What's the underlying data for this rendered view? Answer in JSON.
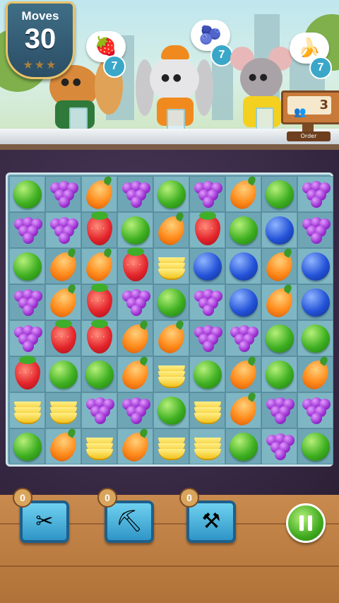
{
  "hud": {
    "moves_label": "Moves",
    "moves_value": "30",
    "order_label": "Order",
    "order_value": "3"
  },
  "customers": [
    {
      "name_icon": "squirrel",
      "wants": "strawberry",
      "wants_icon": "🍓",
      "count": "7"
    },
    {
      "name_icon": "bunny",
      "wants": "blueberry",
      "wants_icon": "🫐",
      "count": "7"
    },
    {
      "name_icon": "mouse",
      "wants": "banana",
      "wants_icon": "🍌",
      "count": "7"
    }
  ],
  "board": {
    "rows": [
      [
        "green",
        "grape",
        "orange",
        "grape",
        "green",
        "grape",
        "orange",
        "green",
        "grape"
      ],
      [
        "grape",
        "grape",
        "straw",
        "green",
        "orange",
        "straw",
        "green",
        "blue",
        "grape"
      ],
      [
        "green",
        "orange",
        "orange",
        "straw",
        "banana",
        "blue",
        "blue",
        "orange",
        "blue"
      ],
      [
        "grape",
        "orange",
        "straw",
        "grape",
        "green",
        "grape",
        "blue",
        "orange",
        "blue"
      ],
      [
        "grape",
        "straw",
        "straw",
        "orange",
        "orange",
        "grape",
        "grape",
        "green",
        "green"
      ],
      [
        "straw",
        "green",
        "green",
        "orange",
        "banana",
        "green",
        "orange",
        "green",
        "orange"
      ],
      [
        "banana",
        "banana",
        "grape",
        "grape",
        "green",
        "banana",
        "orange",
        "grape",
        "grape"
      ],
      [
        "green",
        "orange",
        "banana",
        "orange",
        "banana",
        "banana",
        "green",
        "grape",
        "green"
      ]
    ]
  },
  "boosters": [
    {
      "name": "scissors",
      "icon": "✂",
      "count": "0"
    },
    {
      "name": "hammer",
      "icon": "⛏",
      "count": "0"
    },
    {
      "name": "shovel",
      "icon": "⚒",
      "count": "0"
    }
  ]
}
